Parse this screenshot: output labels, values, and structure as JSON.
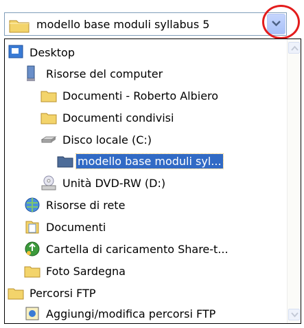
{
  "combo": {
    "current_label": "modello base moduli syllabus 5",
    "icon": "folder-icon"
  },
  "dropdown": {
    "items": [
      {
        "label": "Desktop",
        "icon": "desktop-icon"
      },
      {
        "label": "Risorse del computer",
        "icon": "my-computer-icon"
      },
      {
        "label": "Documenti - Roberto Albiero",
        "icon": "folder-icon"
      },
      {
        "label": "Documenti condivisi",
        "icon": "folder-icon"
      },
      {
        "label": "Disco locale (C:)",
        "icon": "hard-disk-icon"
      },
      {
        "label": "modello base moduli syl...",
        "icon": "folder-icon",
        "selected": true
      },
      {
        "label": "Unità DVD-RW (D:)",
        "icon": "dvd-drive-icon"
      },
      {
        "label": "Risorse di rete",
        "icon": "network-icon"
      },
      {
        "label": "Documenti",
        "icon": "documents-icon"
      },
      {
        "label": "Cartella di caricamento Share-t...",
        "icon": "share-upload-icon"
      },
      {
        "label": "Foto Sardegna",
        "icon": "folder-icon"
      },
      {
        "label": "Percorsi FTP",
        "icon": "folder-icon"
      },
      {
        "label": "Aggiungi/modifica percorsi FTP",
        "icon": "ftp-edit-icon"
      }
    ]
  },
  "colors": {
    "selection": "#316ac5",
    "callout": "#e31c1c",
    "folder": "#f3d46b"
  }
}
